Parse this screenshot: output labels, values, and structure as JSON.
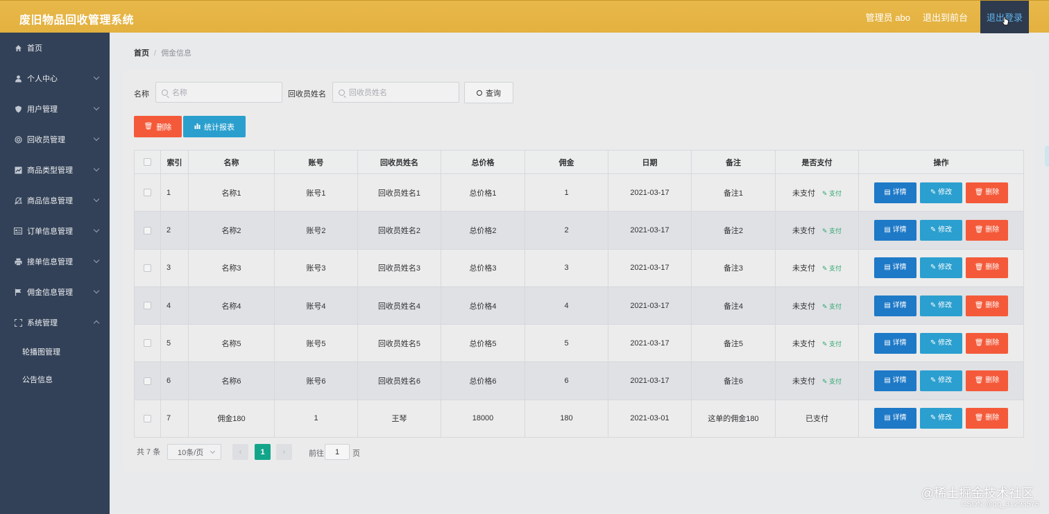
{
  "header": {
    "title": "废旧物品回收管理系统",
    "admin_label": "管理员 abo",
    "back_front": "退出到前台",
    "logout": "退出登录"
  },
  "sidebar": {
    "items": [
      {
        "label": "首页",
        "icon": "home-icon",
        "has_chevron": false
      },
      {
        "label": "个人中心",
        "icon": "user-icon",
        "has_chevron": true
      },
      {
        "label": "用户管理",
        "icon": "shield-icon",
        "has_chevron": true
      },
      {
        "label": "回收员管理",
        "icon": "circle-icon",
        "has_chevron": true
      },
      {
        "label": "商品类型管理",
        "icon": "chart-icon",
        "has_chevron": true
      },
      {
        "label": "商品信息管理",
        "icon": "bell-icon",
        "has_chevron": true
      },
      {
        "label": "订单信息管理",
        "icon": "card-icon",
        "has_chevron": true
      },
      {
        "label": "接单信息管理",
        "icon": "printer-icon",
        "has_chevron": true
      },
      {
        "label": "佣金信息管理",
        "icon": "flag-icon",
        "has_chevron": true
      },
      {
        "label": "系统管理",
        "icon": "fullscreen-icon",
        "has_chevron": true
      }
    ],
    "sub_items": [
      "轮播图管理",
      "公告信息"
    ]
  },
  "breadcrumb": {
    "home": "首页",
    "separator": "/",
    "current": "佣金信息"
  },
  "filters": {
    "name_label": "名称",
    "name_placeholder": "名称",
    "collector_label": "回收员姓名",
    "collector_placeholder": "回收员姓名",
    "query_label": "查询"
  },
  "actions": {
    "delete_label": "删除",
    "stats_label": "统计报表"
  },
  "table": {
    "columns": [
      "索引",
      "名称",
      "账号",
      "回收员姓名",
      "总价格",
      "佣金",
      "日期",
      "备注",
      "是否支付",
      "操作"
    ],
    "rows": [
      {
        "index": "1",
        "name": "名称1",
        "account": "账号1",
        "collector": "回收员姓名1",
        "total": "总价格1",
        "commission": "1",
        "date": "2021-03-17",
        "note": "备注1",
        "paid": "未支付",
        "pay_action": "支付"
      },
      {
        "index": "2",
        "name": "名称2",
        "account": "账号2",
        "collector": "回收员姓名2",
        "total": "总价格2",
        "commission": "2",
        "date": "2021-03-17",
        "note": "备注2",
        "paid": "未支付",
        "pay_action": "支付"
      },
      {
        "index": "3",
        "name": "名称3",
        "account": "账号3",
        "collector": "回收员姓名3",
        "total": "总价格3",
        "commission": "3",
        "date": "2021-03-17",
        "note": "备注3",
        "paid": "未支付",
        "pay_action": "支付"
      },
      {
        "index": "4",
        "name": "名称4",
        "account": "账号4",
        "collector": "回收员姓名4",
        "total": "总价格4",
        "commission": "4",
        "date": "2021-03-17",
        "note": "备注4",
        "paid": "未支付",
        "pay_action": "支付"
      },
      {
        "index": "5",
        "name": "名称5",
        "account": "账号5",
        "collector": "回收员姓名5",
        "total": "总价格5",
        "commission": "5",
        "date": "2021-03-17",
        "note": "备注5",
        "paid": "未支付",
        "pay_action": "支付"
      },
      {
        "index": "6",
        "name": "名称6",
        "account": "账号6",
        "collector": "回收员姓名6",
        "total": "总价格6",
        "commission": "6",
        "date": "2021-03-17",
        "note": "备注6",
        "paid": "未支付",
        "pay_action": "支付"
      },
      {
        "index": "7",
        "name": "佣金180",
        "account": "1",
        "collector": "王琴",
        "total": "18000",
        "commission": "180",
        "date": "2021-03-01",
        "note": "这单的佣金180",
        "paid": "已支付",
        "pay_action": ""
      }
    ],
    "row_actions": {
      "detail": "详情",
      "edit": "修改",
      "delete": "删除"
    }
  },
  "pagination": {
    "total_text": "共 7 条",
    "page_size": "10条/页",
    "current_page": "1",
    "goto_prefix": "前往",
    "goto_value": "1",
    "goto_suffix": "页"
  },
  "watermark": {
    "line1": "@稀土掘金技术社区",
    "line2": "CSDN @qq_31293575"
  },
  "colors": {
    "header_bg": "#e3b13f",
    "sidebar_bg": "#324157",
    "danger": "#f45a3a",
    "info": "#2a9fce",
    "primary": "#1e79c7",
    "page_active": "#13a58a",
    "pay_link": "#2aa46d"
  }
}
